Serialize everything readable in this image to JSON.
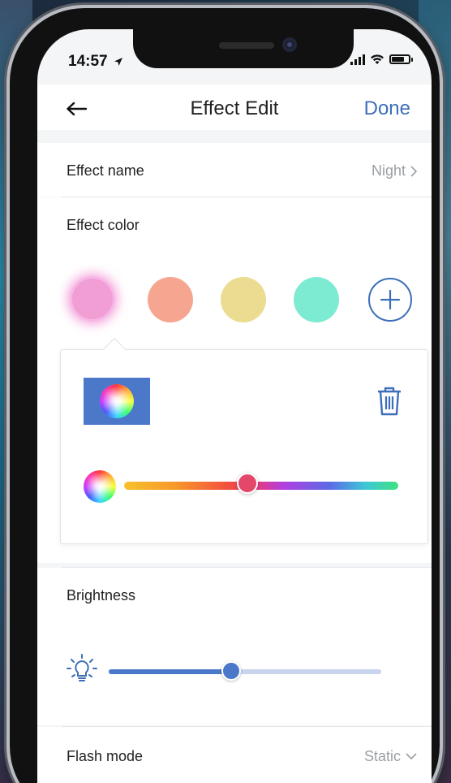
{
  "status_bar": {
    "time": "14:57"
  },
  "nav": {
    "back_icon": "arrow-left-icon",
    "title": "Effect Edit",
    "done_label": "Done"
  },
  "effect_name": {
    "label": "Effect name",
    "value": "Night"
  },
  "effect_color": {
    "label": "Effect color",
    "swatches": [
      {
        "color": "#f09ed3",
        "selected": true
      },
      {
        "color": "#f6a690",
        "selected": false
      },
      {
        "color": "#ecdc92",
        "selected": false
      },
      {
        "color": "#7debd1",
        "selected": false
      }
    ],
    "add_icon": "plus-circle-icon",
    "editor": {
      "preview_color": "#4c78c9",
      "delete_icon": "trash-icon",
      "hue_level": 0.45,
      "hue_color": "#e3476a"
    }
  },
  "brightness": {
    "label": "Brightness",
    "icon": "lightbulb-icon",
    "level": 0.45
  },
  "flash_mode": {
    "label": "Flash mode",
    "value": "Static"
  }
}
